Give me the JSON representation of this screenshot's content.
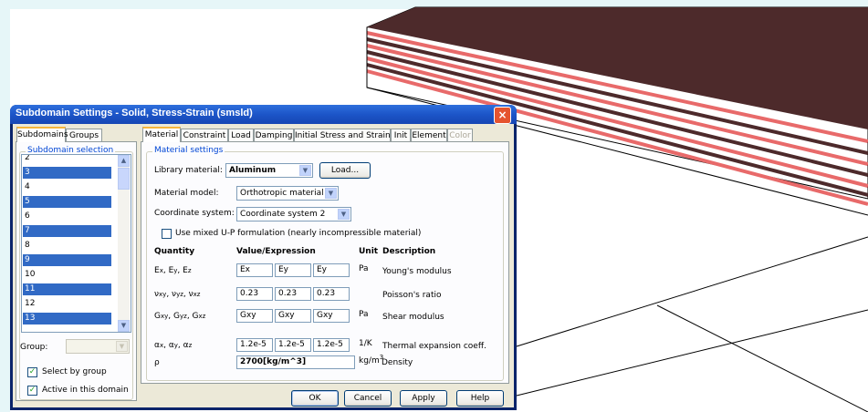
{
  "dialog": {
    "title": "Subdomain Settings - Solid, Stress-Strain (smsld)",
    "close_glyph": "×"
  },
  "left_tabs": [
    "Subdomains",
    "Groups"
  ],
  "subdomain_selection": {
    "legend": "Subdomain selection",
    "items": [
      {
        "label": "2",
        "selected": false
      },
      {
        "label": "3",
        "selected": true
      },
      {
        "label": "4",
        "selected": false
      },
      {
        "label": "5",
        "selected": true
      },
      {
        "label": "6",
        "selected": false
      },
      {
        "label": "7",
        "selected": true
      },
      {
        "label": "8",
        "selected": false
      },
      {
        "label": "9",
        "selected": true
      },
      {
        "label": "10",
        "selected": false
      },
      {
        "label": "11",
        "selected": true
      },
      {
        "label": "12",
        "selected": false
      },
      {
        "label": "13",
        "selected": true
      }
    ],
    "group_label": "Group:",
    "group_value": "",
    "select_by_group": "Select by group",
    "active_in_domain": "Active in this domain"
  },
  "right_tabs": [
    "Material",
    "Constraint",
    "Load",
    "Damping",
    "Initial Stress and Strain",
    "Init",
    "Element",
    "Color"
  ],
  "material": {
    "legend": "Material settings",
    "library_label": "Library material:",
    "library_value": "Aluminum",
    "load_button": "Load...",
    "model_label": "Material model:",
    "model_value": "Orthotropic material",
    "coord_label": "Coordinate system:",
    "coord_value": "Coordinate system 2",
    "mixed_up": "Use mixed U-P formulation (nearly incompressible material)",
    "headers": {
      "quantity": "Quantity",
      "value": "Value/Expression",
      "unit": "Unit",
      "description": "Description"
    },
    "rows": [
      {
        "q": [
          "E",
          "x",
          ", E",
          "y",
          ", E",
          "z"
        ],
        "values": [
          "Ex",
          "Ey",
          "Ey"
        ],
        "unit": "Pa",
        "desc": "Young's modulus"
      },
      {
        "q": [
          "ν",
          "xy",
          ", ν",
          "yz",
          ", ν",
          "xz"
        ],
        "values": [
          "0.23",
          "0.23",
          "0.23"
        ],
        "unit": "",
        "desc": "Poisson's ratio"
      },
      {
        "q": [
          "G",
          "xy",
          ", G",
          "yz",
          ", G",
          "xz"
        ],
        "values": [
          "Gxy",
          "Gxy",
          "Gxy"
        ],
        "unit": "Pa",
        "desc": "Shear modulus"
      },
      {
        "q": [
          "α",
          "x",
          ", α",
          "y",
          ", α",
          "z"
        ],
        "values": [
          "1.2e-5",
          "1.2e-5",
          "1.2e-5"
        ],
        "unit": "1/K",
        "desc": "Thermal expansion coeff."
      }
    ],
    "density": {
      "q": "ρ",
      "value": "2700[kg/m^3]",
      "unit_base": "kg/m",
      "unit_sup": "3",
      "desc": "Density"
    }
  },
  "buttons": {
    "ok": "OK",
    "cancel": "Cancel",
    "apply": "Apply",
    "help": "Help"
  },
  "colors": {
    "layer": "#4d2a2b",
    "layer_edge": "#e86a6a"
  }
}
